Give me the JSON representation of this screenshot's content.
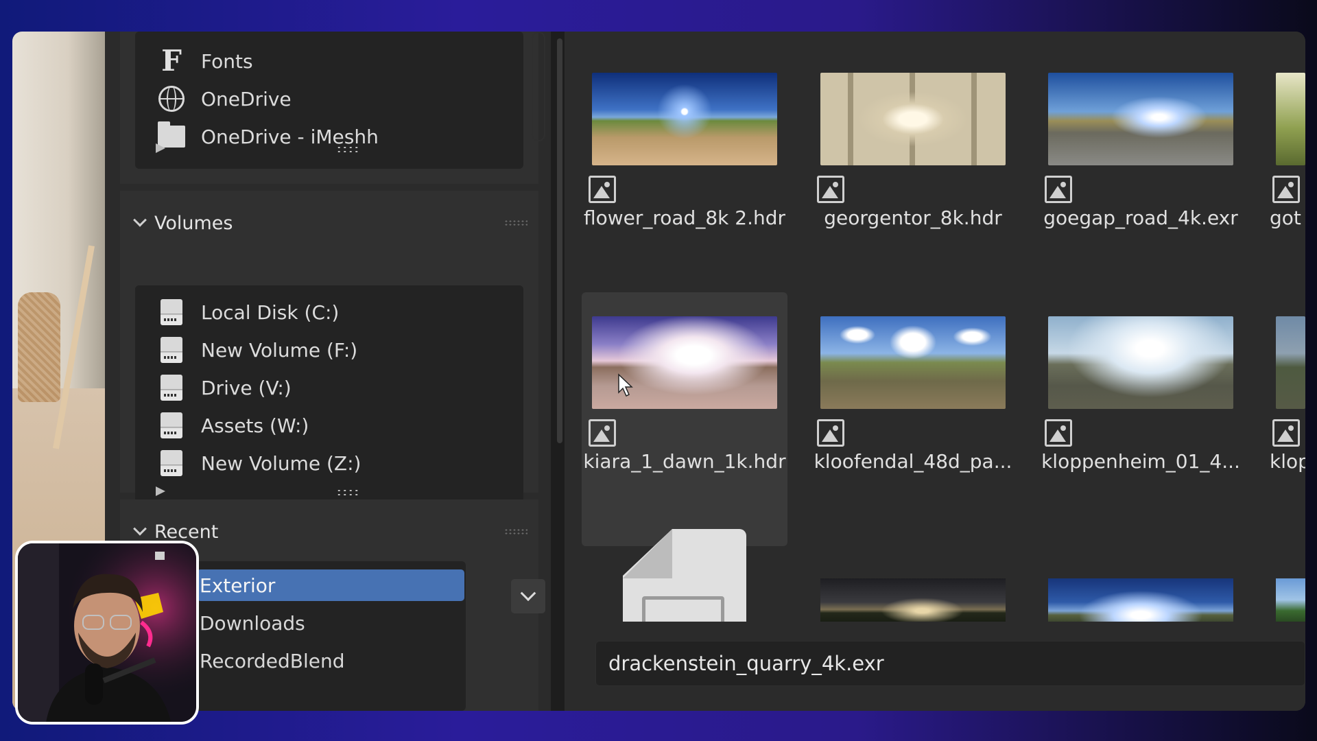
{
  "sidebar": {
    "system_items": [
      {
        "label": "Fonts",
        "icon": "font-icon"
      },
      {
        "label": "OneDrive",
        "icon": "globe-icon"
      },
      {
        "label": "OneDrive - iMeshh",
        "icon": "folder-icon"
      }
    ],
    "volumes": {
      "title": "Volumes",
      "items": [
        {
          "label": "Local Disk (C:)",
          "icon": "drive-icon"
        },
        {
          "label": "New Volume (F:)",
          "icon": "drive-icon"
        },
        {
          "label": "Drive (V:)",
          "icon": "drive-icon"
        },
        {
          "label": "Assets (W:)",
          "icon": "drive-icon"
        },
        {
          "label": "New Volume (Z:)",
          "icon": "drive-icon"
        }
      ]
    },
    "recent": {
      "title": "Recent",
      "items": [
        {
          "label": "Exterior",
          "selected": true
        },
        {
          "label": "Downloads",
          "selected": false
        },
        {
          "label": "RecordedBlend",
          "selected": false
        }
      ]
    }
  },
  "browser": {
    "files": [
      {
        "name": "flower_road_8k 2.hdr"
      },
      {
        "name": "georgentor_8k.hdr"
      },
      {
        "name": "goegap_road_4k.exr"
      },
      {
        "name": "got"
      },
      {
        "name": "kiara_1_dawn_1k.hdr",
        "selected": true
      },
      {
        "name": "kloofendal_48d_pa..."
      },
      {
        "name": "kloppenheim_01_4..."
      },
      {
        "name": "klop"
      }
    ],
    "filename_value": "drackenstein_quarry_4k.exr"
  },
  "colors": {
    "accent": "#4772b3",
    "panel_bg": "#2b2b2b",
    "list_bg": "#232323"
  }
}
